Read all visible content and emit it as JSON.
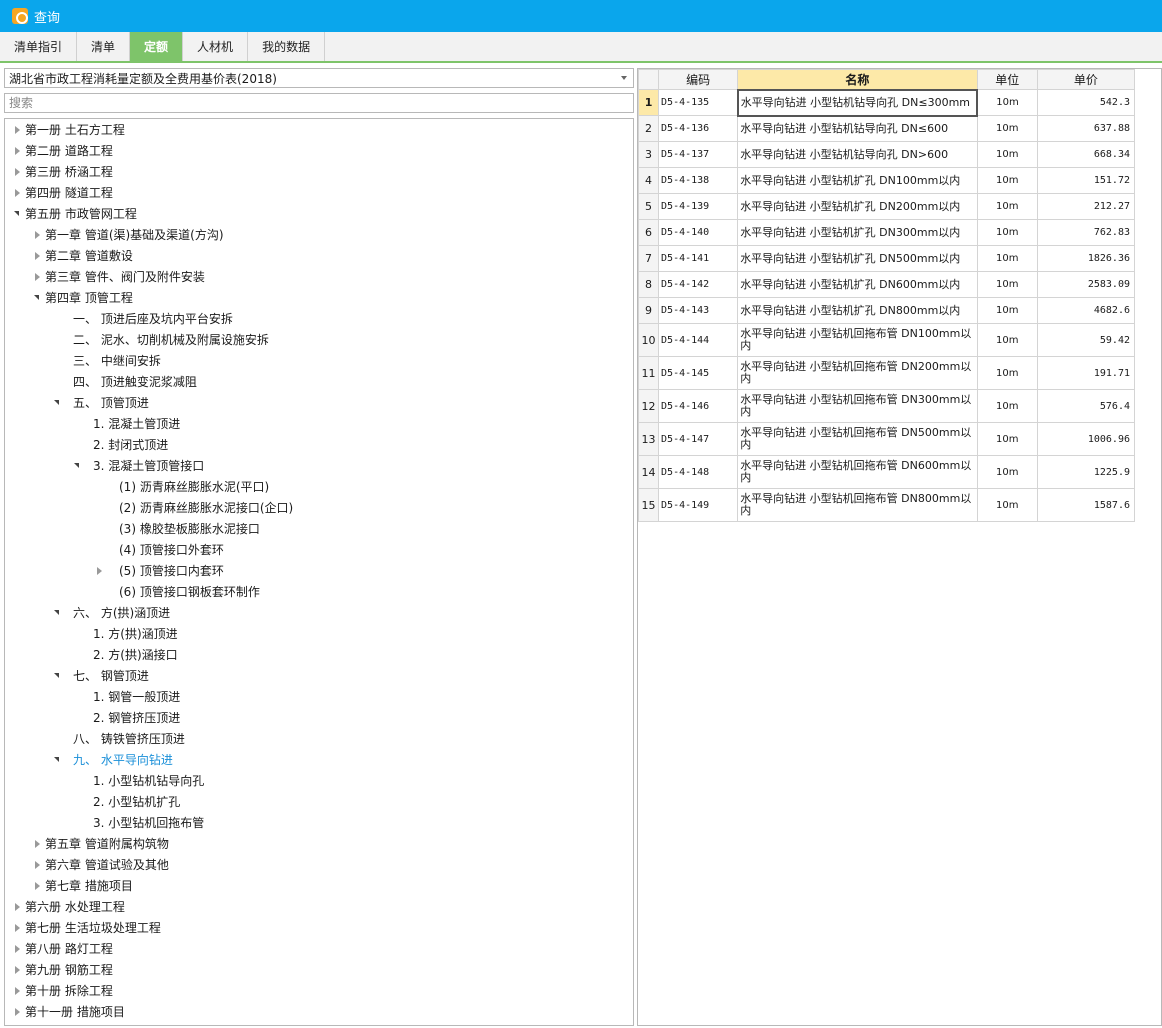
{
  "window": {
    "title": "查询"
  },
  "tabs": [
    {
      "label": "清单指引",
      "active": false
    },
    {
      "label": "清单",
      "active": false
    },
    {
      "label": "定额",
      "active": true
    },
    {
      "label": "人材机",
      "active": false
    },
    {
      "label": "我的数据",
      "active": false
    }
  ],
  "left_panel": {
    "library_select": "湖北省市政工程消耗量定额及全费用基价表(2018)",
    "search_placeholder": "搜索",
    "tree": [
      {
        "label": "第一册 土石方工程",
        "level": 0,
        "state": "collapsed"
      },
      {
        "label": "第二册 道路工程",
        "level": 0,
        "state": "collapsed"
      },
      {
        "label": "第三册 桥涵工程",
        "level": 0,
        "state": "collapsed"
      },
      {
        "label": "第四册 隧道工程",
        "level": 0,
        "state": "collapsed"
      },
      {
        "label": "第五册 市政管网工程",
        "level": 0,
        "state": "expanded"
      },
      {
        "label": "第一章 管道(渠)基础及渠道(方沟)",
        "level": 1,
        "state": "collapsed"
      },
      {
        "label": "第二章 管道敷设",
        "level": 1,
        "state": "collapsed"
      },
      {
        "label": "第三章 管件、阀门及附件安装",
        "level": 1,
        "state": "collapsed"
      },
      {
        "label": "第四章 顶管工程",
        "level": 1,
        "state": "expanded"
      },
      {
        "label": "一、 顶进后座及坑内平台安拆",
        "level": 2,
        "state": "leaf"
      },
      {
        "label": "二、 泥水、切削机械及附属设施安拆",
        "level": 2,
        "state": "leaf"
      },
      {
        "label": "三、 中继间安拆",
        "level": 2,
        "state": "leaf"
      },
      {
        "label": "四、 顶进触变泥浆减阻",
        "level": 2,
        "state": "leaf"
      },
      {
        "label": "五、 顶管顶进",
        "level": 2,
        "state": "expanded"
      },
      {
        "label": "1. 混凝土管顶进",
        "level": 3,
        "state": "leaf"
      },
      {
        "label": "2. 封闭式顶进",
        "level": 3,
        "state": "leaf"
      },
      {
        "label": "3. 混凝土管顶管接口",
        "level": 3,
        "state": "expanded"
      },
      {
        "label": "(1) 沥青麻丝膨胀水泥(平口)",
        "level": 4,
        "state": "leaf"
      },
      {
        "label": "(2) 沥青麻丝膨胀水泥接口(企口)",
        "level": 4,
        "state": "leaf"
      },
      {
        "label": "(3) 橡胶垫板膨胀水泥接口",
        "level": 4,
        "state": "leaf"
      },
      {
        "label": "(4) 顶管接口外套环",
        "level": 4,
        "state": "leaf"
      },
      {
        "label": "(5) 顶管接口内套环",
        "level": 4,
        "state": "collapsed"
      },
      {
        "label": "(6) 顶管接口钢板套环制作",
        "level": 4,
        "state": "leaf"
      },
      {
        "label": "六、 方(拱)涵顶进",
        "level": 2,
        "state": "expanded"
      },
      {
        "label": "1. 方(拱)涵顶进",
        "level": 3,
        "state": "leaf"
      },
      {
        "label": "2. 方(拱)涵接口",
        "level": 3,
        "state": "leaf"
      },
      {
        "label": "七、 钢管顶进",
        "level": 2,
        "state": "expanded"
      },
      {
        "label": "1. 钢管一般顶进",
        "level": 3,
        "state": "leaf"
      },
      {
        "label": "2. 钢管挤压顶进",
        "level": 3,
        "state": "leaf"
      },
      {
        "label": "八、 铸铁管挤压顶进",
        "level": 2,
        "state": "leaf"
      },
      {
        "label": "九、 水平导向钻进",
        "level": 2,
        "state": "expanded",
        "selected": true
      },
      {
        "label": "1. 小型钻机钻导向孔",
        "level": 3,
        "state": "leaf"
      },
      {
        "label": "2. 小型钻机扩孔",
        "level": 3,
        "state": "leaf"
      },
      {
        "label": "3. 小型钻机回拖布管",
        "level": 3,
        "state": "leaf"
      },
      {
        "label": "第五章 管道附属构筑物",
        "level": 1,
        "state": "collapsed"
      },
      {
        "label": "第六章 管道试验及其他",
        "level": 1,
        "state": "collapsed"
      },
      {
        "label": "第七章 措施项目",
        "level": 1,
        "state": "collapsed"
      },
      {
        "label": "第六册 水处理工程",
        "level": 0,
        "state": "collapsed"
      },
      {
        "label": "第七册 生活垃圾处理工程",
        "level": 0,
        "state": "collapsed"
      },
      {
        "label": "第八册 路灯工程",
        "level": 0,
        "state": "collapsed"
      },
      {
        "label": "第九册 钢筋工程",
        "level": 0,
        "state": "collapsed"
      },
      {
        "label": "第十册 拆除工程",
        "level": 0,
        "state": "collapsed"
      },
      {
        "label": "第十一册 措施项目",
        "level": 0,
        "state": "collapsed"
      }
    ]
  },
  "grid": {
    "columns": [
      "编码",
      "名称",
      "单位",
      "单价"
    ],
    "rows": [
      {
        "no": "1",
        "code": "D5-4-135",
        "name": "水平导向钻进 小型钻机钻导向孔 DN≤300mm",
        "unit": "10m",
        "price": "542.3"
      },
      {
        "no": "2",
        "code": "D5-4-136",
        "name": "水平导向钻进 小型钻机钻导向孔 DN≤600",
        "unit": "10m",
        "price": "637.88"
      },
      {
        "no": "3",
        "code": "D5-4-137",
        "name": "水平导向钻进 小型钻机钻导向孔 DN>600",
        "unit": "10m",
        "price": "668.34"
      },
      {
        "no": "4",
        "code": "D5-4-138",
        "name": "水平导向钻进 小型钻机扩孔 DN100mm以内",
        "unit": "10m",
        "price": "151.72"
      },
      {
        "no": "5",
        "code": "D5-4-139",
        "name": "水平导向钻进 小型钻机扩孔 DN200mm以内",
        "unit": "10m",
        "price": "212.27"
      },
      {
        "no": "6",
        "code": "D5-4-140",
        "name": "水平导向钻进 小型钻机扩孔 DN300mm以内",
        "unit": "10m",
        "price": "762.83"
      },
      {
        "no": "7",
        "code": "D5-4-141",
        "name": "水平导向钻进 小型钻机扩孔 DN500mm以内",
        "unit": "10m",
        "price": "1826.36"
      },
      {
        "no": "8",
        "code": "D5-4-142",
        "name": "水平导向钻进 小型钻机扩孔 DN600mm以内",
        "unit": "10m",
        "price": "2583.09"
      },
      {
        "no": "9",
        "code": "D5-4-143",
        "name": "水平导向钻进 小型钻机扩孔 DN800mm以内",
        "unit": "10m",
        "price": "4682.6"
      },
      {
        "no": "10",
        "code": "D5-4-144",
        "name": "水平导向钻进 小型钻机回拖布管 DN100mm以内",
        "unit": "10m",
        "price": "59.42"
      },
      {
        "no": "11",
        "code": "D5-4-145",
        "name": "水平导向钻进 小型钻机回拖布管 DN200mm以内",
        "unit": "10m",
        "price": "191.71"
      },
      {
        "no": "12",
        "code": "D5-4-146",
        "name": "水平导向钻进 小型钻机回拖布管 DN300mm以内",
        "unit": "10m",
        "price": "576.4"
      },
      {
        "no": "13",
        "code": "D5-4-147",
        "name": "水平导向钻进 小型钻机回拖布管 DN500mm以内",
        "unit": "10m",
        "price": "1006.96"
      },
      {
        "no": "14",
        "code": "D5-4-148",
        "name": "水平导向钻进 小型钻机回拖布管 DN600mm以内",
        "unit": "10m",
        "price": "1225.9"
      },
      {
        "no": "15",
        "code": "D5-4-149",
        "name": "水平导向钻进 小型钻机回拖布管 DN800mm以内",
        "unit": "10m",
        "price": "1587.6"
      }
    ]
  },
  "colors": {
    "title_bar": "#0aa6ec",
    "active_tab": "#7ec46a",
    "header_highlight": "#fde9a8",
    "selected_text": "#1a8fd8"
  }
}
